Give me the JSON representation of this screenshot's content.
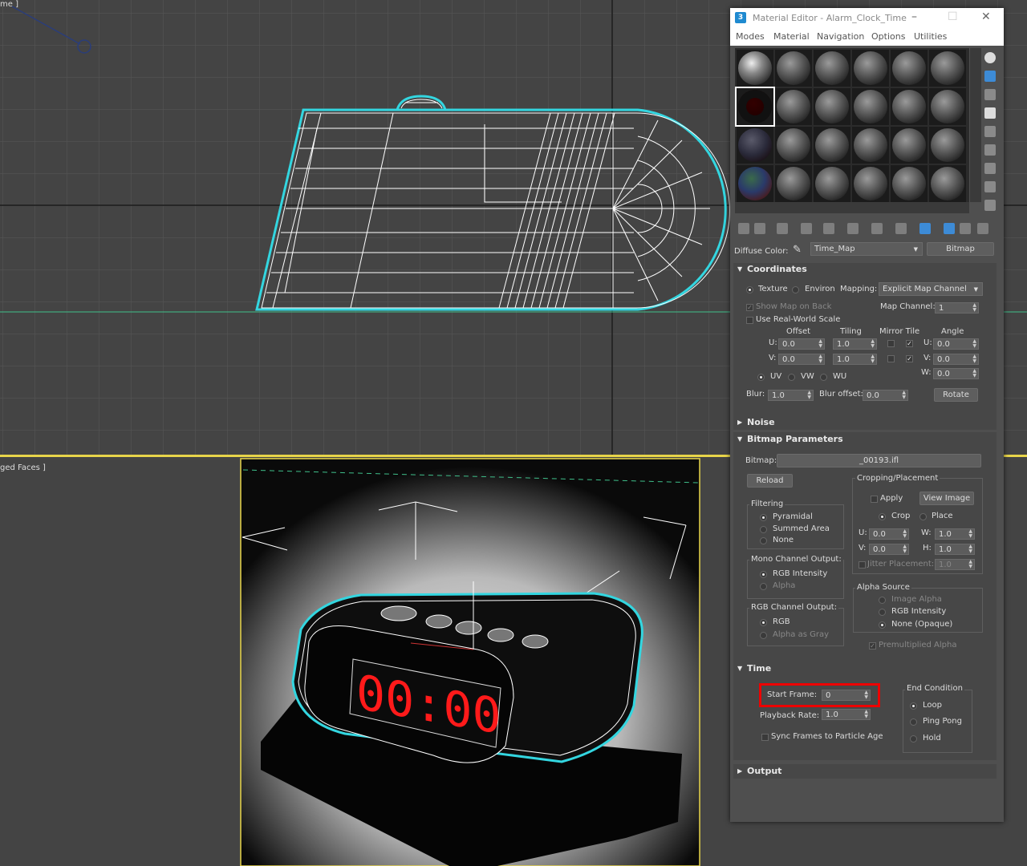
{
  "viewport_top": {
    "label": "me ]"
  },
  "viewport_bottom": {
    "label": "ged Faces ]"
  },
  "render": {
    "clock_display": "00:00"
  },
  "material_editor": {
    "title": "Material Editor - Alarm_Clock_Time",
    "menu": [
      "Modes",
      "Material",
      "Navigation",
      "Options",
      "Utilities"
    ],
    "diffuse_label": "Diffuse Color:",
    "map_name": "Time_Map",
    "map_type_button": "Bitmap",
    "coordinates": {
      "header": "Coordinates",
      "texture": "Texture",
      "environ": "Environ",
      "mapping_label": "Mapping:",
      "mapping_value": "Explicit Map Channel",
      "show_map_on_back": "Show Map on Back",
      "map_channel_label": "Map Channel:",
      "map_channel_value": "1",
      "use_real_world_scale": "Use Real-World Scale",
      "col_offset": "Offset",
      "col_tiling": "Tiling",
      "col_mirror_tile": "Mirror Tile",
      "col_angle": "Angle",
      "u_label": "U:",
      "v_label": "V:",
      "w_label": "W:",
      "u_offset": "0.0",
      "v_offset": "0.0",
      "u_tiling": "1.0",
      "v_tiling": "1.0",
      "u_angle": "0.0",
      "v_angle": "0.0",
      "w_angle": "0.0",
      "uv": "UV",
      "vw": "VW",
      "wu": "WU",
      "blur_label": "Blur:",
      "blur_value": "1.0",
      "blur_offset_label": "Blur offset:",
      "blur_offset_value": "0.0",
      "rotate_button": "Rotate"
    },
    "noise": {
      "header": "Noise"
    },
    "bitmap_params": {
      "header": "Bitmap Parameters",
      "bitmap_label": "Bitmap:",
      "bitmap_value": "_00193.ifl",
      "reload_button": "Reload",
      "cropping_label": "Cropping/Placement",
      "apply": "Apply",
      "view_image_button": "View Image",
      "crop": "Crop",
      "place": "Place",
      "u_label": "U:",
      "v_label": "V:",
      "w_label": "W:",
      "h_label": "H:",
      "crop_u": "0.0",
      "crop_v": "0.0",
      "crop_w": "1.0",
      "crop_h": "1.0",
      "jitter_label": "Jitter Placement:",
      "jitter_value": "1.0",
      "filtering_label": "Filtering",
      "pyramidal": "Pyramidal",
      "summed_area": "Summed Area",
      "none": "None",
      "mono_label": "Mono Channel Output:",
      "rgb_intensity": "RGB Intensity",
      "alpha": "Alpha",
      "rgb_channel_label": "RGB Channel Output:",
      "rgb": "RGB",
      "alpha_as_gray": "Alpha as Gray",
      "alpha_source_label": "Alpha Source",
      "image_alpha": "Image Alpha",
      "rgb_intensity_src": "RGB Intensity",
      "none_opaque": "None (Opaque)",
      "premultiplied_alpha": "Premultiplied Alpha"
    },
    "time": {
      "header": "Time",
      "start_frame_label": "Start Frame:",
      "start_frame_value": "0",
      "playback_rate_label": "Playback Rate:",
      "playback_rate_value": "1.0",
      "sync_frames": "Sync Frames to Particle Age",
      "end_condition_label": "End Condition",
      "loop": "Loop",
      "ping_pong": "Ping Pong",
      "hold": "Hold"
    },
    "output": {
      "header": "Output"
    }
  },
  "colors": {
    "viewport_bg": "#444444",
    "grid_line": "#555555",
    "selection_cyan": "#33d6e0",
    "viewport_border": "#e8d54a",
    "highlight_red": "#ee0000",
    "clock_red": "#ff1a1a"
  }
}
